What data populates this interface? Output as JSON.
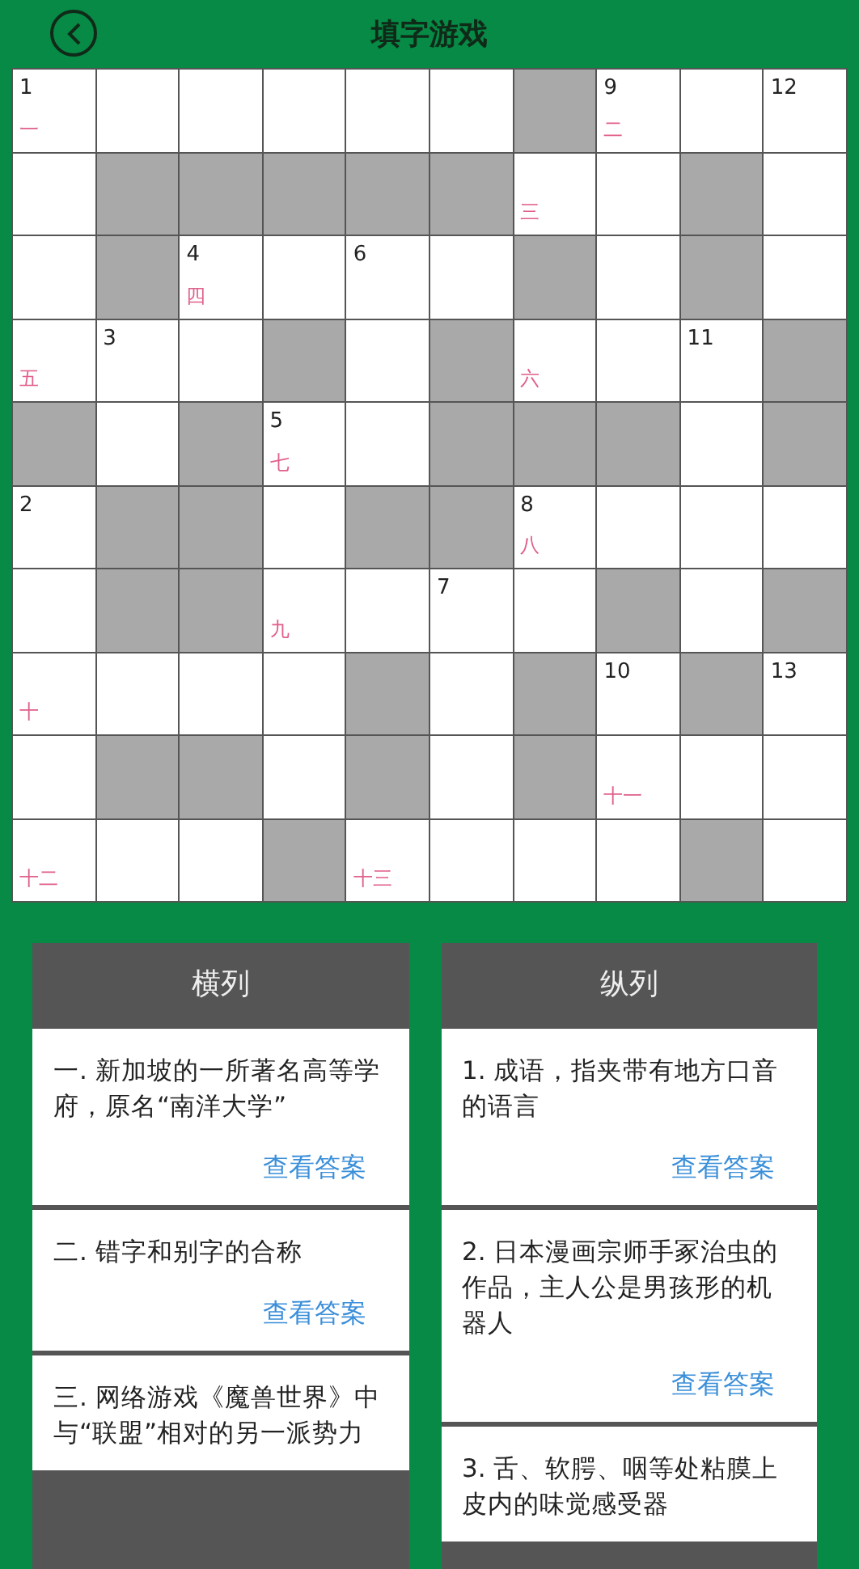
{
  "header": {
    "title": "填字游戏"
  },
  "grid": [
    [
      {
        "blocked": false,
        "number": "1",
        "mark": "一"
      },
      {
        "blocked": false
      },
      {
        "blocked": false
      },
      {
        "blocked": false
      },
      {
        "blocked": false
      },
      {
        "blocked": false
      },
      {
        "blocked": true
      },
      {
        "blocked": false,
        "number": "9",
        "mark": "二"
      },
      {
        "blocked": false
      },
      {
        "blocked": false,
        "number": "12"
      }
    ],
    [
      {
        "blocked": false
      },
      {
        "blocked": true
      },
      {
        "blocked": true
      },
      {
        "blocked": true
      },
      {
        "blocked": true
      },
      {
        "blocked": true
      },
      {
        "blocked": false,
        "mark": "三"
      },
      {
        "blocked": false
      },
      {
        "blocked": true
      },
      {
        "blocked": false
      }
    ],
    [
      {
        "blocked": false
      },
      {
        "blocked": true
      },
      {
        "blocked": false,
        "number": "4",
        "mark": "四"
      },
      {
        "blocked": false
      },
      {
        "blocked": false,
        "number": "6"
      },
      {
        "blocked": false
      },
      {
        "blocked": true
      },
      {
        "blocked": false
      },
      {
        "blocked": true
      },
      {
        "blocked": false
      }
    ],
    [
      {
        "blocked": false,
        "mark": "五"
      },
      {
        "blocked": false,
        "number": "3"
      },
      {
        "blocked": false
      },
      {
        "blocked": true
      },
      {
        "blocked": false
      },
      {
        "blocked": true
      },
      {
        "blocked": false,
        "mark": "六"
      },
      {
        "blocked": false
      },
      {
        "blocked": false,
        "number": "11"
      },
      {
        "blocked": true
      }
    ],
    [
      {
        "blocked": true
      },
      {
        "blocked": false
      },
      {
        "blocked": true
      },
      {
        "blocked": false,
        "number": "5",
        "mark": "七"
      },
      {
        "blocked": false
      },
      {
        "blocked": true
      },
      {
        "blocked": true
      },
      {
        "blocked": true
      },
      {
        "blocked": false
      },
      {
        "blocked": true
      }
    ],
    [
      {
        "blocked": false,
        "number": "2"
      },
      {
        "blocked": true
      },
      {
        "blocked": true
      },
      {
        "blocked": false
      },
      {
        "blocked": true
      },
      {
        "blocked": true
      },
      {
        "blocked": false,
        "number": "8",
        "mark": "八"
      },
      {
        "blocked": false
      },
      {
        "blocked": false
      },
      {
        "blocked": false
      }
    ],
    [
      {
        "blocked": false
      },
      {
        "blocked": true
      },
      {
        "blocked": true
      },
      {
        "blocked": false,
        "mark": "九"
      },
      {
        "blocked": false
      },
      {
        "blocked": false,
        "number": "7"
      },
      {
        "blocked": false
      },
      {
        "blocked": true
      },
      {
        "blocked": false
      },
      {
        "blocked": true
      }
    ],
    [
      {
        "blocked": false,
        "mark": "十"
      },
      {
        "blocked": false
      },
      {
        "blocked": false
      },
      {
        "blocked": false
      },
      {
        "blocked": true
      },
      {
        "blocked": false
      },
      {
        "blocked": true
      },
      {
        "blocked": false,
        "number": "10"
      },
      {
        "blocked": true
      },
      {
        "blocked": false,
        "number": "13"
      }
    ],
    [
      {
        "blocked": false
      },
      {
        "blocked": true
      },
      {
        "blocked": true
      },
      {
        "blocked": false
      },
      {
        "blocked": true
      },
      {
        "blocked": false
      },
      {
        "blocked": true
      },
      {
        "blocked": false,
        "mark": "十一"
      },
      {
        "blocked": false
      },
      {
        "blocked": false
      }
    ],
    [
      {
        "blocked": false,
        "mark": "十二"
      },
      {
        "blocked": false
      },
      {
        "blocked": false
      },
      {
        "blocked": true
      },
      {
        "blocked": false,
        "mark": "十三"
      },
      {
        "blocked": false
      },
      {
        "blocked": false
      },
      {
        "blocked": false
      },
      {
        "blocked": true
      },
      {
        "blocked": false
      }
    ]
  ],
  "panels": [
    {
      "title": "横列",
      "clues": [
        {
          "text": "一. 新加坡的一所著名高等学府，原名“南洋大学”",
          "action": "查看答案"
        },
        {
          "text": "二. 错字和别字的合称",
          "action": "查看答案"
        },
        {
          "text": "三. 网络游戏《魔兽世界》中与“联盟”相对的另一派势力"
        }
      ]
    },
    {
      "title": "纵列",
      "clues": [
        {
          "text": "1. 成语，指夹带有地方口音的语言",
          "action": "查看答案"
        },
        {
          "text": "2. 日本漫画宗师手冢治虫的作品，主人公是男孩形的机器人",
          "action": "查看答案"
        },
        {
          "text": "3. 舌、软腭、咽等处粘膜上皮内的味觉感受器"
        }
      ]
    }
  ]
}
